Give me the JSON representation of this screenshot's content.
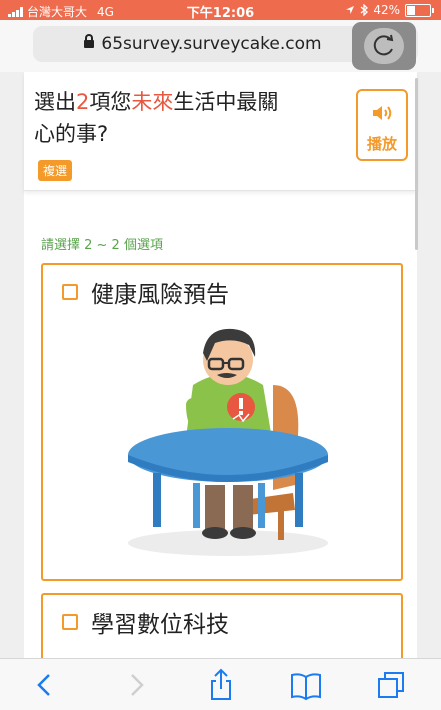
{
  "status_bar": {
    "carrier": "台灣大哥大",
    "network": "4G",
    "time": "下午12:06",
    "battery": "42%",
    "battery_level": 0.42,
    "icons": [
      "signal-icon",
      "location-icon",
      "bluetooth-icon",
      "battery-icon"
    ]
  },
  "browser": {
    "url": "65survey.surveycake.com",
    "icons": [
      "lock-icon",
      "reload-icon"
    ]
  },
  "question": {
    "title_parts": {
      "p1": "選出",
      "p2": "2",
      "p3": "項您",
      "p4": "未來",
      "p5": "生活中最關",
      "p6": "心的事?"
    },
    "badge": "複選",
    "play_label": "播放",
    "hint": "請選擇 2 ~ 2 個選項",
    "accent_color": "#f39a2b",
    "highlight_color": "#e8573f"
  },
  "options": [
    {
      "label": "健康風險預告"
    },
    {
      "label": "學習數位科技"
    }
  ],
  "toolbar": {
    "icons": [
      "back-icon",
      "forward-icon",
      "share-icon",
      "bookmarks-icon",
      "tabs-icon"
    ]
  }
}
